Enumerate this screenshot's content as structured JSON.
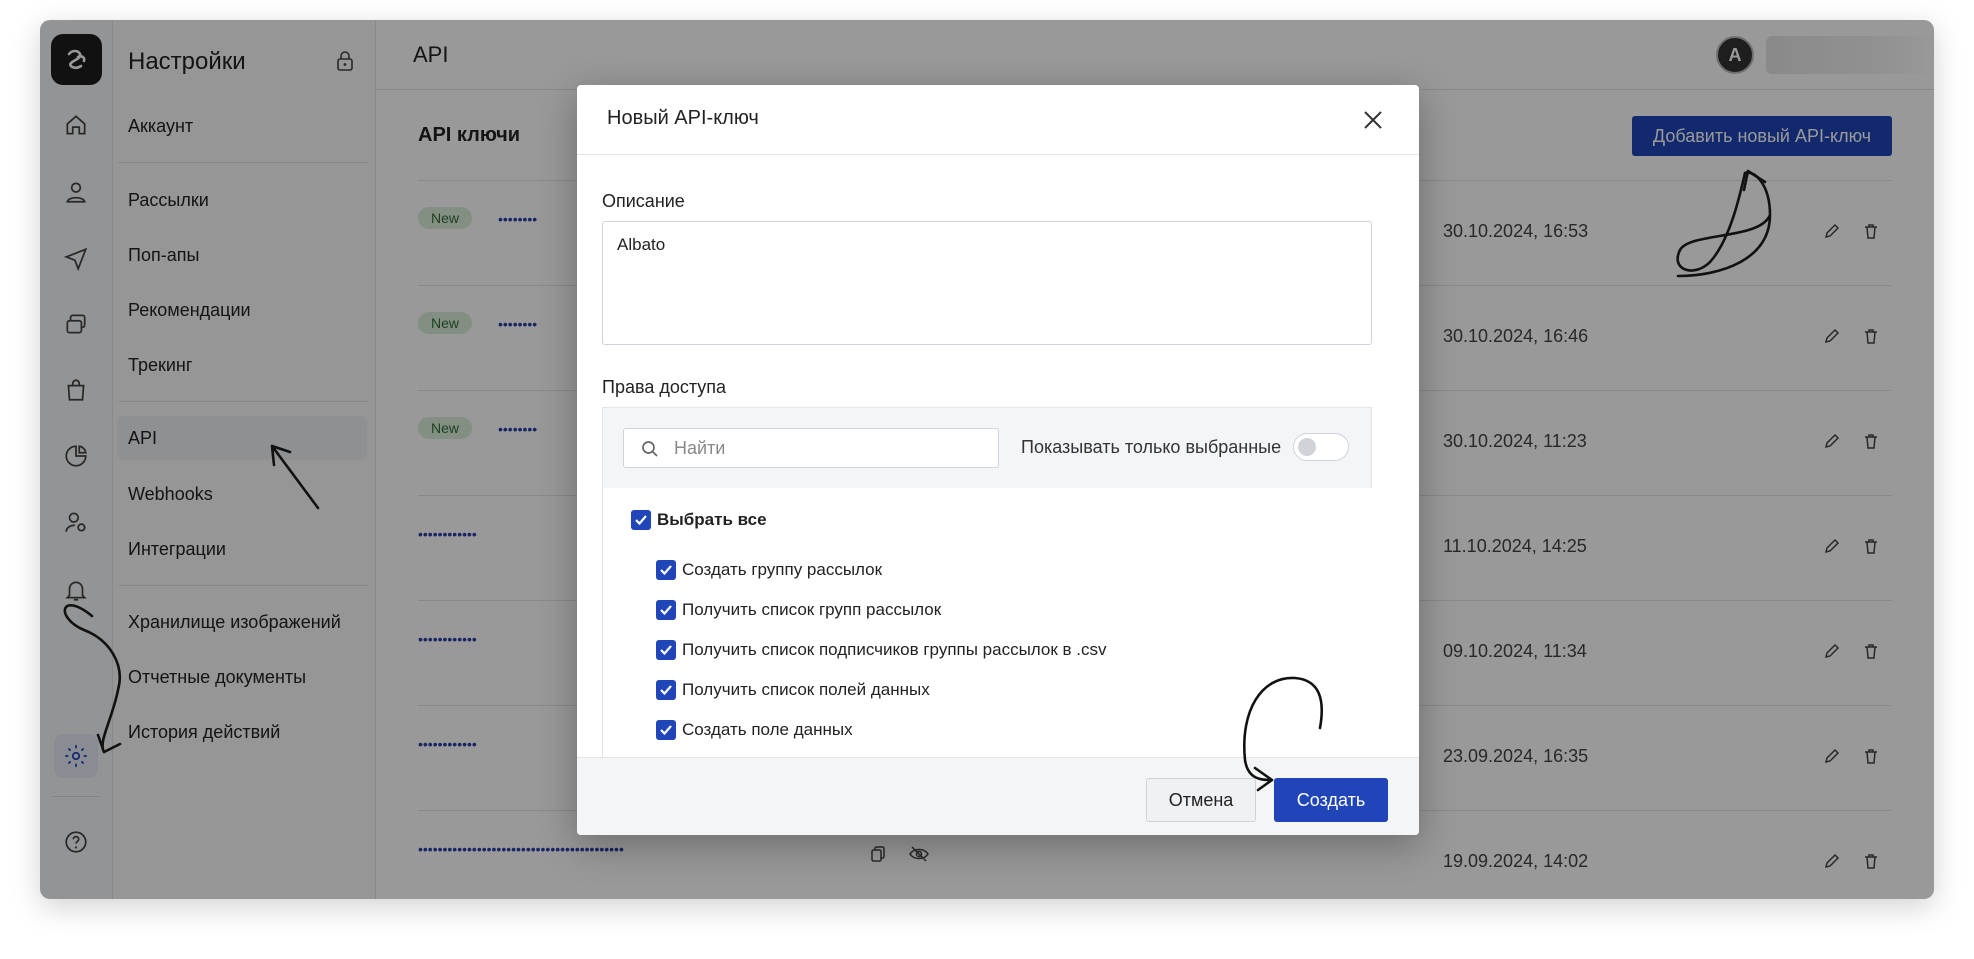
{
  "settings": {
    "title": "Настройки",
    "menu": [
      {
        "label": "Аккаунт"
      },
      {
        "label": "Рассылки"
      },
      {
        "label": "Поп-апы"
      },
      {
        "label": "Рекомендации"
      },
      {
        "label": "Трекинг"
      },
      {
        "label": "API"
      },
      {
        "label": "Webhooks"
      },
      {
        "label": "Интеграции"
      },
      {
        "label": "Хранилище изображений"
      },
      {
        "label": "Отчетные документы"
      },
      {
        "label": "История действий"
      }
    ],
    "active_item": "API"
  },
  "header": {
    "title": "API",
    "avatar_letter": "A"
  },
  "api_keys": {
    "title": "API ключи",
    "add_button": "Добавить новый API-ключ",
    "rows": [
      {
        "badge": "New",
        "key": "••••••••",
        "date": "30.10.2024, 16:53"
      },
      {
        "badge": "New",
        "key": "••••••••",
        "date": "30.10.2024, 16:46"
      },
      {
        "badge": "New",
        "key": "••••••••",
        "date": "30.10.2024, 11:23"
      },
      {
        "badge": "",
        "key": "••••••••••••",
        "date": "11.10.2024, 14:25"
      },
      {
        "badge": "",
        "key": "••••••••••••",
        "date": "09.10.2024, 11:34"
      },
      {
        "badge": "",
        "key": "••••••••••••",
        "date": "23.09.2024, 16:35"
      },
      {
        "badge": "",
        "key": "••••••••••••••••••••••••••••••••••••••••••",
        "date": "19.09.2024, 14:02"
      }
    ]
  },
  "modal": {
    "title": "Новый API-ключ",
    "description_label": "Описание",
    "description_value": "Albato",
    "permissions_label": "Права доступа",
    "search_placeholder": "Найти",
    "toggle_label": "Показывать только выбранные",
    "select_all": "Выбрать все",
    "permissions": [
      "Создать группу рассылок",
      "Получить список групп рассылок",
      "Получить список подписчиков группы рассылок в .csv",
      "Получить список полей данных",
      "Создать поле данных"
    ],
    "cancel_button": "Отмена",
    "create_button": "Создать"
  },
  "colors": {
    "primary": "#1f45b8",
    "badge_bg": "#dbeed9",
    "badge_text": "#356b38",
    "overlay": "rgba(0,0,0,0.40)"
  }
}
